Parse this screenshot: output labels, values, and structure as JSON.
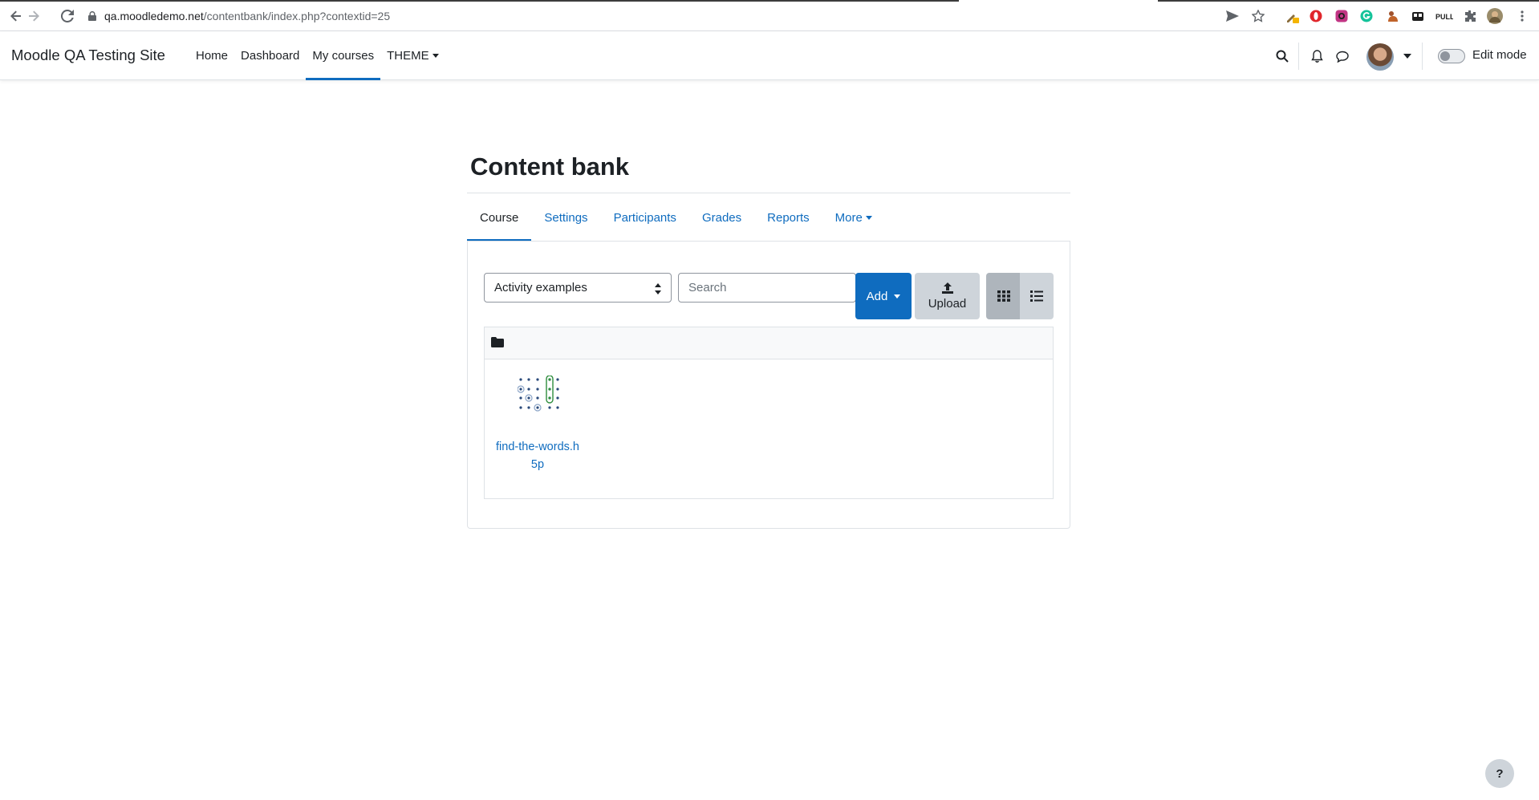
{
  "browser": {
    "url_host": "qa.moodledemo.net",
    "url_path": "/contentbank/index.php?contextid=25"
  },
  "navbar": {
    "site_name": "Moodle QA Testing Site",
    "items": [
      {
        "label": "Home"
      },
      {
        "label": "Dashboard"
      },
      {
        "label": "My courses"
      },
      {
        "label": "THEME"
      }
    ],
    "edit_mode_label": "Edit mode"
  },
  "page": {
    "title": "Content bank",
    "tabs": [
      {
        "label": "Course"
      },
      {
        "label": "Settings"
      },
      {
        "label": "Participants"
      },
      {
        "label": "Grades"
      },
      {
        "label": "Reports"
      },
      {
        "label": "More"
      }
    ]
  },
  "toolbar": {
    "context_select_value": "Activity examples",
    "search_placeholder": "Search",
    "add_label": "Add",
    "upload_label": "Upload"
  },
  "files": [
    {
      "name": "find-the-words.h5p",
      "icon": "h5p-find-the-words-icon"
    }
  ],
  "help": {
    "label": "?"
  },
  "colors": {
    "accent": "#0f6cbf",
    "button_secondary": "#ced4da",
    "text": "#1d2125"
  }
}
